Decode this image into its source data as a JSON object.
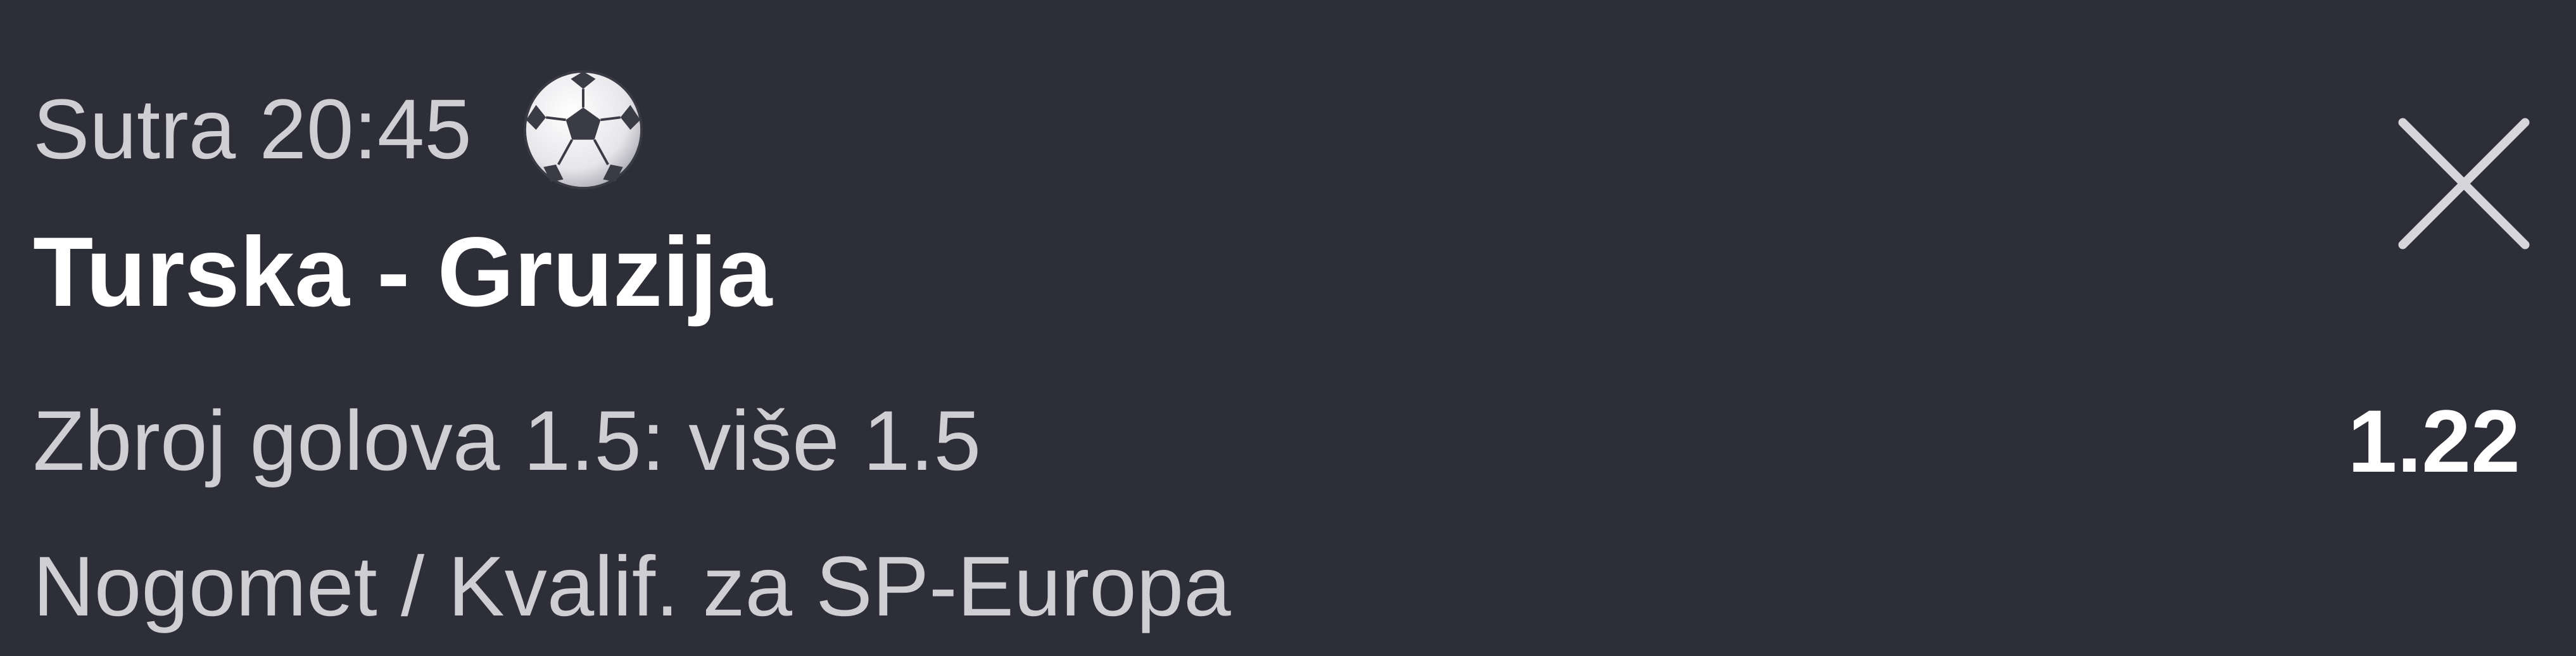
{
  "bet_slip_item": {
    "kickoff": "Sutra 20:45",
    "sport_icon": "soccer-ball-icon",
    "match": "Turska - Gruzija",
    "selection": "Zbroj golova 1.5: više 1.5",
    "odds": "1.22",
    "competition": "Nogomet / Kvalif. za SP-Europa",
    "close_icon": "close-icon"
  },
  "colors": {
    "background": "#2e2e38",
    "primary_text": "#ffffff",
    "secondary_text": "#cfcfd3"
  }
}
